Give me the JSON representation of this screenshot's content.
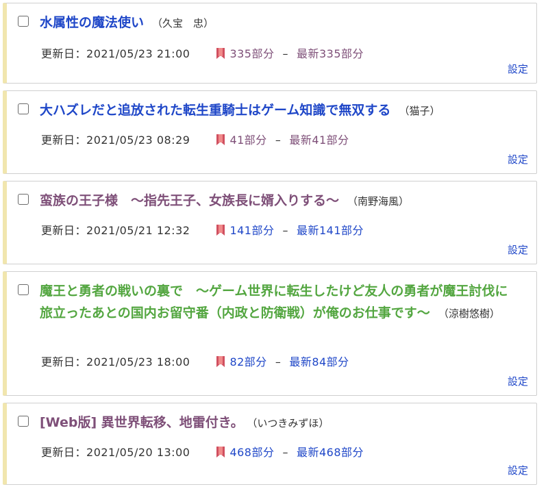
{
  "labels": {
    "updated_prefix": "更新日：",
    "settings": "設定",
    "dash": "–"
  },
  "colors": {
    "title_blue": "#1f47c8",
    "title_purple": "#7e4f78",
    "title_green": "#53a640",
    "card_accent": "#f1e6ae",
    "bookmark": "#d05060"
  },
  "items": [
    {
      "title": "水属性の魔法使い",
      "author": "（久宝　忠）",
      "updated": "2021/05/23 21:00",
      "bookmark": "335部分",
      "latest": "最新335部分"
    },
    {
      "title": "大ハズレだと追放された転生重騎士はゲーム知識で無双する",
      "author": "（猫子）",
      "updated": "2021/05/23 08:29",
      "bookmark": "41部分",
      "latest": "最新41部分"
    },
    {
      "title": "蛮族の王子様　～指先王子、女族長に婿入りする～",
      "author": "（南野海風）",
      "updated": "2021/05/21 12:32",
      "bookmark": "141部分",
      "latest": "最新141部分"
    },
    {
      "title": "魔王と勇者の戦いの裏で　～ゲーム世界に転生したけど友人の勇者が魔王討伐に旅立ったあとの国内お留守番（内政と防衛戦）が俺のお仕事です～",
      "author": "（涼樹悠樹）",
      "updated": "2021/05/23 18:00",
      "bookmark": "82部分",
      "latest": "最新84部分"
    },
    {
      "title": "[Web版] 異世界転移、地雷付き。",
      "author": "（いつきみずほ）",
      "updated": "2021/05/20 13:00",
      "bookmark": "468部分",
      "latest": "最新468部分"
    }
  ]
}
